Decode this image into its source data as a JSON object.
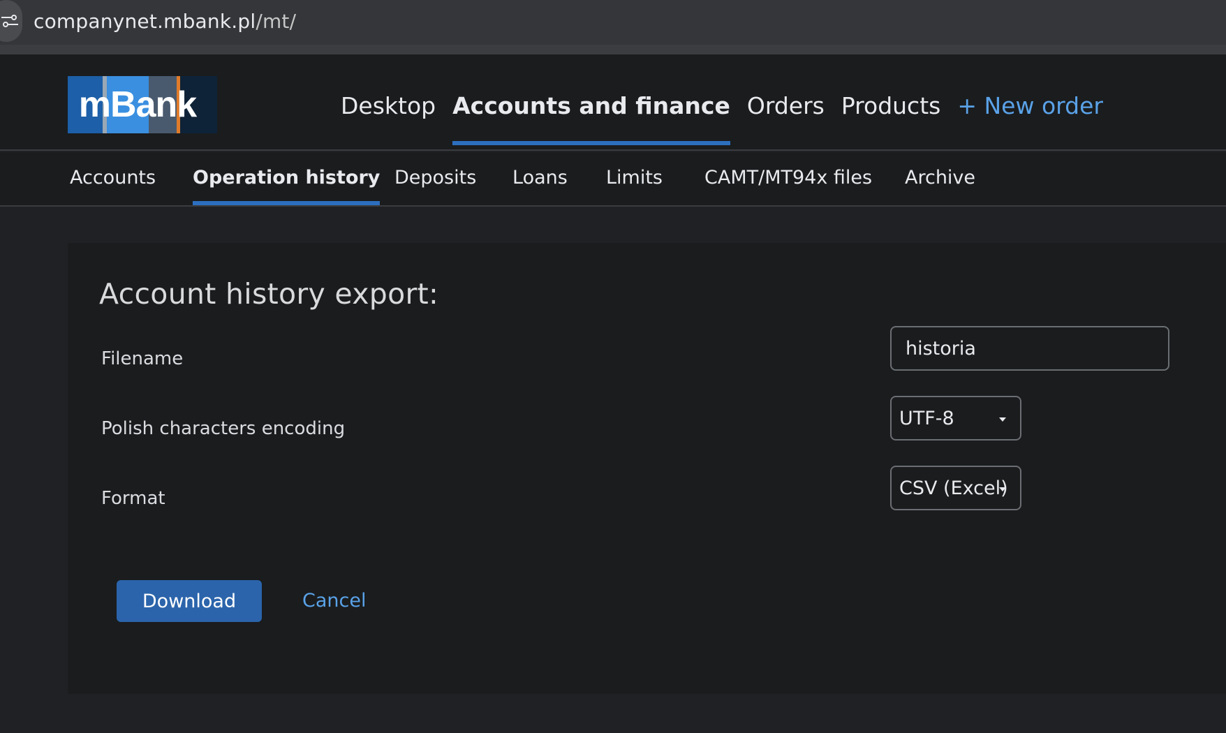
{
  "browser": {
    "url_host": "companynet.mbank.pl",
    "url_path": "/mt/",
    "site_info_icon": "tune-icon"
  },
  "header": {
    "logo_text": "mBank",
    "logo_colors": [
      "#1d5fa8",
      "#2f86d6",
      "#3a8fe0",
      "#9aa7b4",
      "#4a5a6e",
      "#e07b2a",
      "#0f2338"
    ],
    "nav": [
      {
        "label": "Desktop",
        "active": false
      },
      {
        "label": "Accounts and finance",
        "active": true
      },
      {
        "label": "Orders",
        "active": false
      },
      {
        "label": "Products",
        "active": false
      },
      {
        "label": "+ New order",
        "active": false
      }
    ]
  },
  "subnav": {
    "items": [
      {
        "label": "Accounts",
        "active": false
      },
      {
        "label": "Operation history",
        "active": true
      },
      {
        "label": "Deposits",
        "active": false
      },
      {
        "label": "Loans",
        "active": false
      },
      {
        "label": "Limits",
        "active": false
      },
      {
        "label": "CAMT/MT94x files",
        "active": false
      },
      {
        "label": "Archive",
        "active": false
      }
    ]
  },
  "export": {
    "title": "Account history export:",
    "filename_label": "Filename",
    "filename_value": "historia",
    "encoding_label": "Polish characters encoding",
    "encoding_value": "UTF-8",
    "format_label": "Format",
    "format_value": "CSV (Excel)",
    "download_label": "Download",
    "cancel_label": "Cancel"
  },
  "colors": {
    "accent": "#2d6fbf",
    "link": "#5aa2e8",
    "button": "#2b64ab",
    "background": "#1a1c1e"
  }
}
